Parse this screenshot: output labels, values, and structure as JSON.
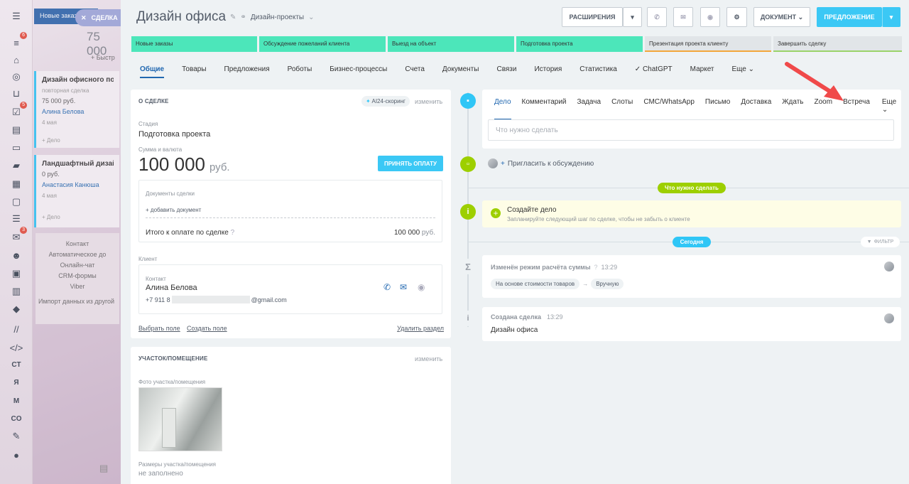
{
  "rail": {
    "badges": {
      "filter": "6",
      "tasks": "5",
      "mail": "3"
    },
    "labels": {
      "ct": "CT",
      "ya": "Я",
      "m": "M",
      "co": "CO"
    }
  },
  "board": {
    "column_tab": "Новые заказы",
    "column_sum": "75 000",
    "quick_add": "+ Быстр",
    "cards": [
      {
        "title": "Дизайн офисного помещ",
        "subtitle": "повторная сделка",
        "amount": "75 000 руб.",
        "contact": "Алина Белова",
        "date": "4 мая",
        "add": "+ Дело"
      },
      {
        "title": "Ландшафтный дизайн_бол",
        "subtitle": "",
        "amount": "0 руб.",
        "contact": "Анастасия Канюша",
        "date": "4 мая",
        "add": "+ Дело"
      }
    ],
    "automation": {
      "title": "Контакт",
      "subtitle": "Автоматическое до",
      "items": [
        "Онлайн-чат",
        "CRM-формы",
        "Viber"
      ],
      "import": "Импорт данных из другой"
    }
  },
  "sdelka_label": "СДЕЛКА",
  "header": {
    "title": "Дизайн офиса",
    "category": "Дизайн-проекты",
    "btn_extensions": "РАСШИРЕНИЯ",
    "btn_document": "ДОКУМЕНТ",
    "btn_offer": "ПРЕДЛОЖЕНИЕ"
  },
  "stages": [
    "Новые заказы",
    "Обсуждение пожеланий клиента",
    "Выезд на объект",
    "Подготовка проекта",
    "Презентация проекта клиенту",
    "Завершить сделку"
  ],
  "tabs": [
    "Общие",
    "Товары",
    "Предложения",
    "Роботы",
    "Бизнес-процессы",
    "Счета",
    "Документы",
    "Связи",
    "История",
    "Статистика",
    "✓ ChatGPT",
    "Маркет",
    "Еще"
  ],
  "deal": {
    "section_title": "О СДЕЛКЕ",
    "ai_scoring": "AI24-скоринг",
    "edit": "изменить",
    "stage_label": "Стадия",
    "stage_value": "Подготовка проекта",
    "sum_label": "Сумма и валюта",
    "sum_value": "100 000",
    "currency": "руб.",
    "pay_button": "ПРИНЯТЬ ОПЛАТУ",
    "docs_label": "Документы сделки",
    "add_doc": "+ добавить документ",
    "total_label": "Итого к оплате по сделке",
    "total_value": "100 000",
    "total_currency": "руб.",
    "client_label": "Клиент",
    "contact_label": "Контакт",
    "contact_name": "Алина Белова",
    "contact_phone": "+7 911 8",
    "contact_email": "@gmail.com",
    "link_select_field": "Выбрать поле",
    "link_create_field": "Создать поле",
    "link_delete_section": "Удалить раздел"
  },
  "premises": {
    "section_title": "УЧАСТОК/ПОМЕЩЕНИЕ",
    "edit": "изменить",
    "photo_label": "Фото участка/помещения",
    "size_label": "Размеры участка/помещения",
    "size_value": "не заполнено"
  },
  "activity": {
    "tabs": [
      "Дело",
      "Комментарий",
      "Задача",
      "Слоты",
      "СМС/WhatsApp",
      "Письмо",
      "Доставка",
      "Ждать",
      "Zoom",
      "Встреча",
      "Еще"
    ],
    "input_placeholder": "Что нужно сделать",
    "invite": "Пригласить к обсуждению",
    "todo_pill": "Что нужно сделать",
    "create_title": "Создайте дело",
    "create_hint": "Запланируйте следующий шаг по сделке, чтобы не забыть о клиенте",
    "today_pill": "Сегодня",
    "filter": "ФИЛЬТР"
  },
  "timeline": [
    {
      "title": "Изменён режим расчёта суммы",
      "time": "13:29",
      "from": "На основе стоимости товаров",
      "to": "Вручную"
    },
    {
      "title": "Создана сделка",
      "time": "13:29",
      "body": "Дизайн офиса"
    }
  ],
  "colors": {
    "accent": "#3bc8f5",
    "link": "#2067b0",
    "stage_active": "#4ce6ba",
    "green": "#9dcf00",
    "arrow": "#f04a4a"
  }
}
